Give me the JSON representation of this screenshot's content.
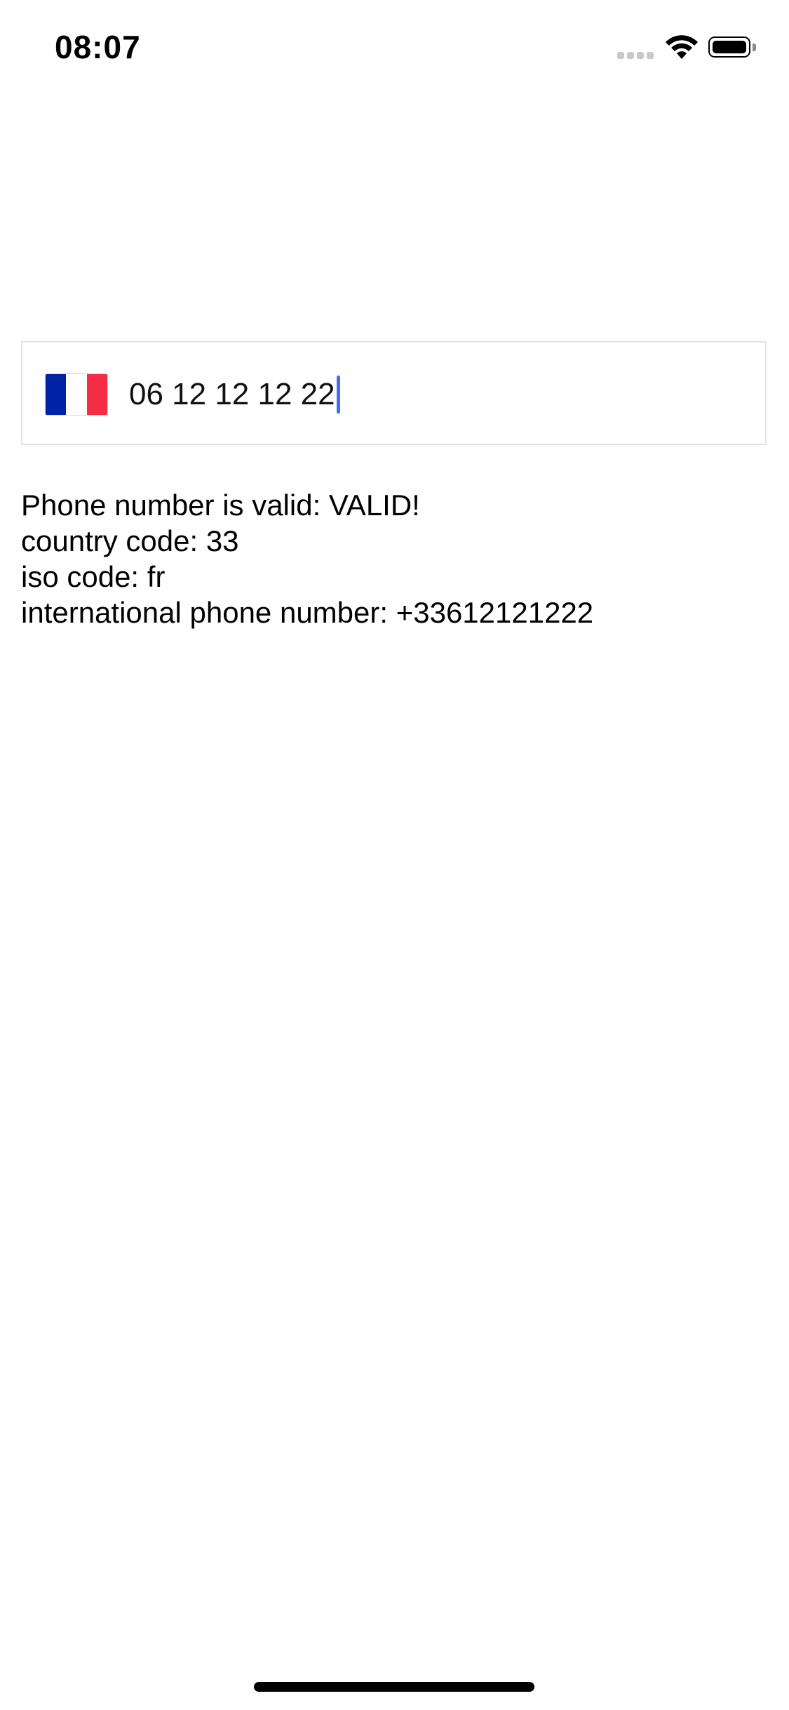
{
  "status_bar": {
    "time": "08:07",
    "icons": [
      "signal-icon",
      "wifi-icon",
      "battery-icon"
    ]
  },
  "phone_input": {
    "flag": {
      "icon": "france-flag-icon",
      "colors": [
        "#0022a4",
        "#ffffff",
        "#f42d45"
      ]
    },
    "value": "06 12 12 12 22",
    "cursor_color": "#3d6ef5",
    "border_color": "#e4e4e4"
  },
  "info": {
    "valid_line": "Phone number is valid: VALID!",
    "country_code_line": "country code: 33",
    "iso_code_line": "iso code: fr",
    "international_line": "international phone number: +33612121222"
  }
}
